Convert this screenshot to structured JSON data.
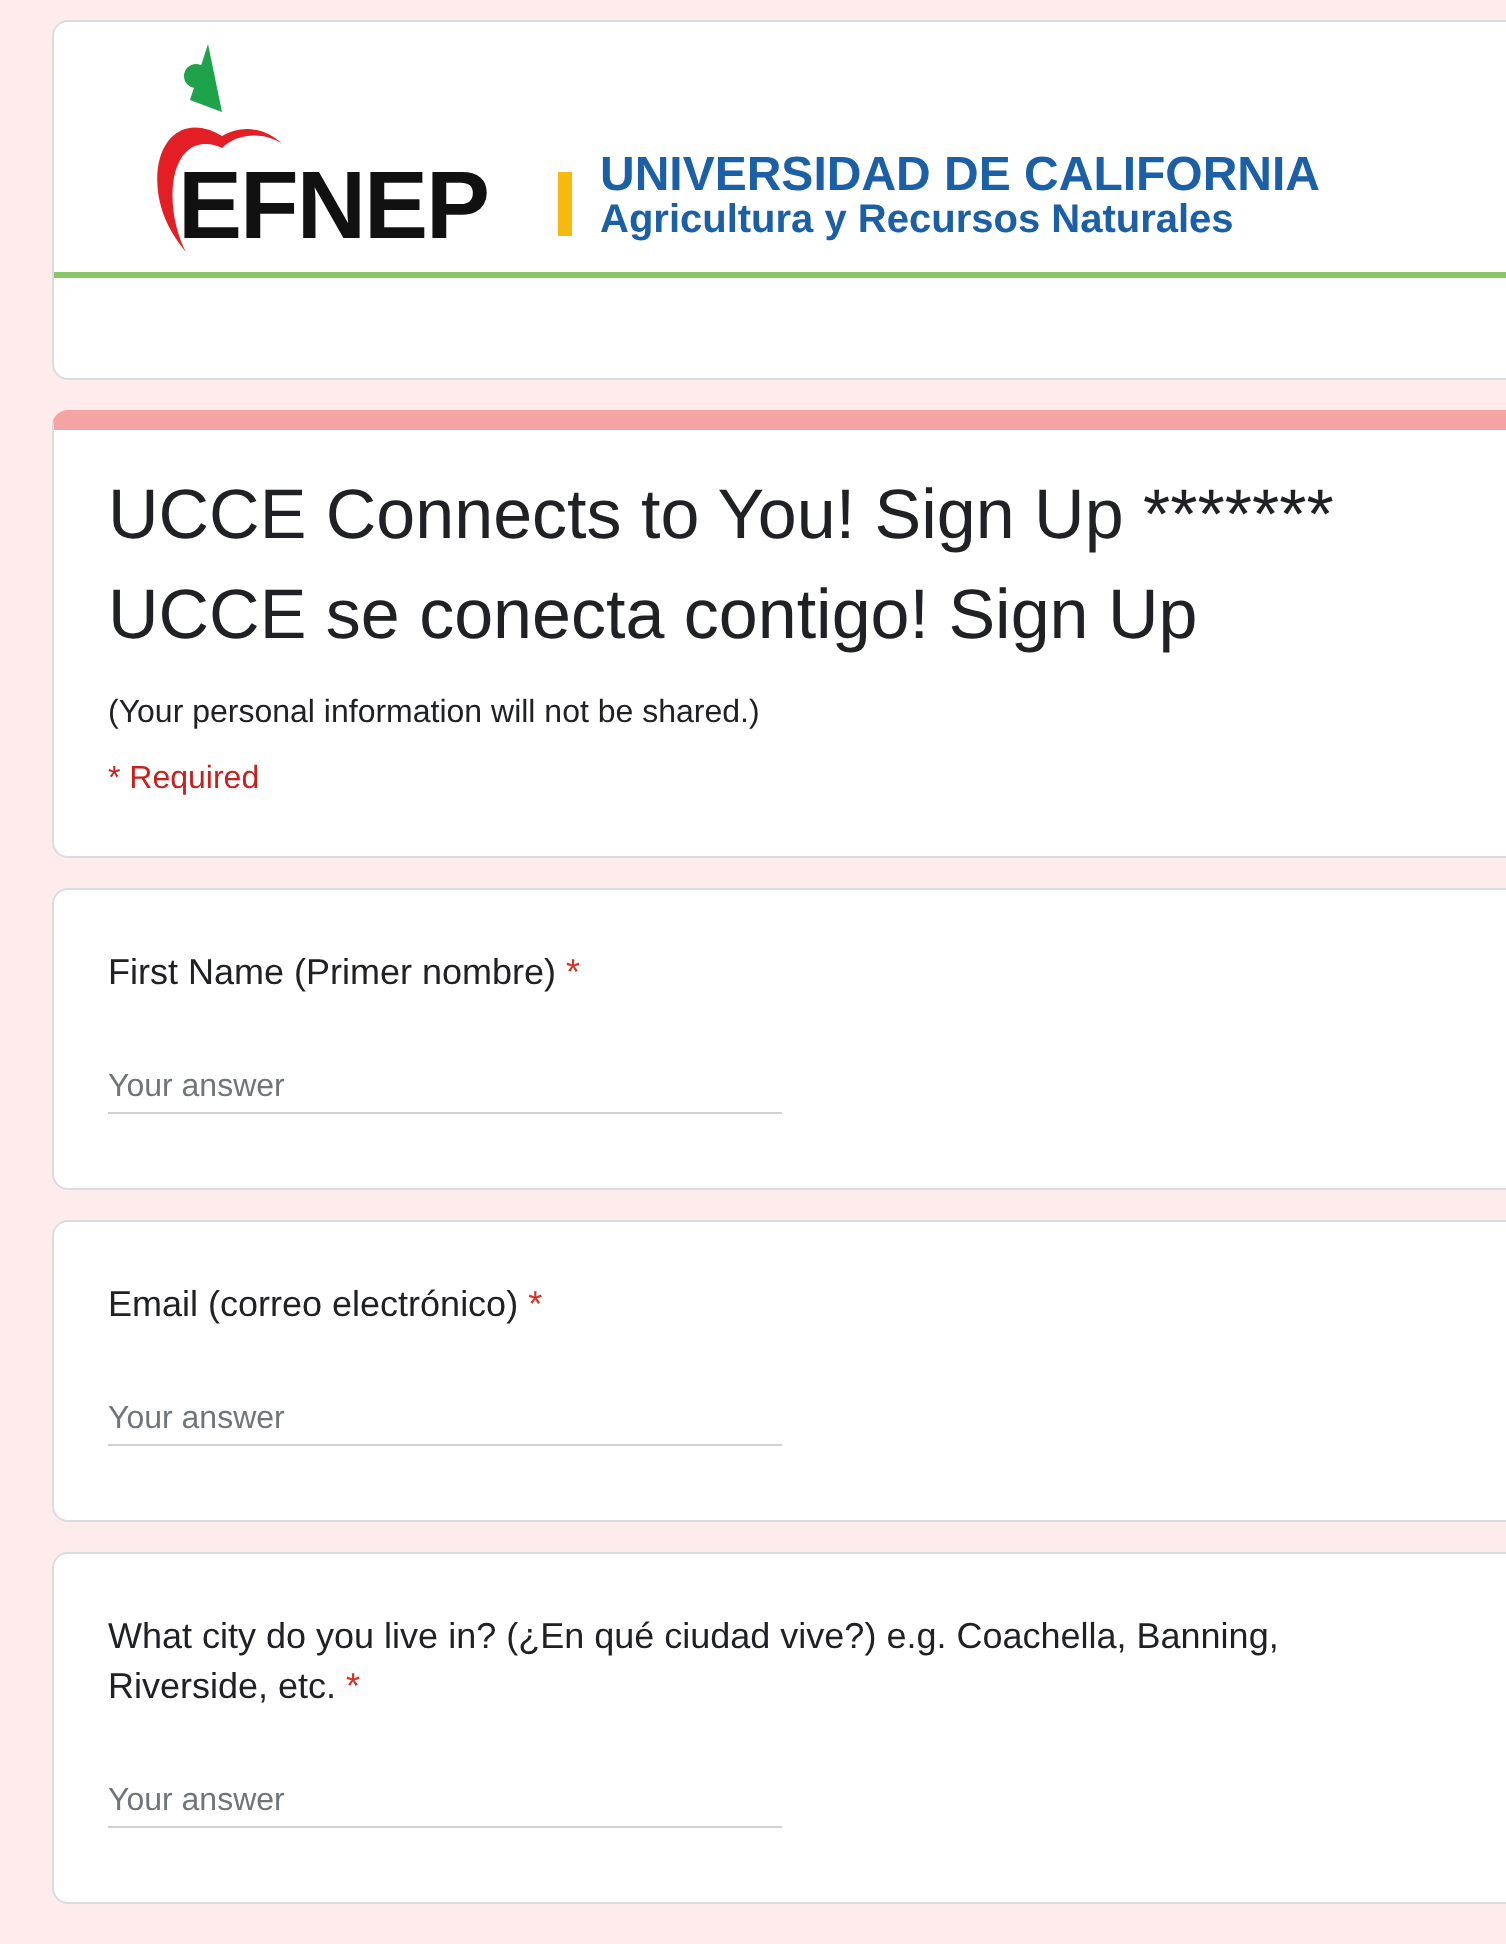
{
  "header": {
    "logo_text": "EFNEP",
    "university": "UNIVERSIDAD DE CALIFORNIA",
    "division": "Agricultura y Recursos Naturales"
  },
  "form": {
    "title_lines": [
      "UCCE Connects to You! Sign Up *******",
      "UCCE se conecta contigo! Sign Up"
    ],
    "description": "(Your personal information will not be shared.)",
    "required_note": "* Required"
  },
  "questions": [
    {
      "label": "First Name (Primer nombre)",
      "required_mark": "*",
      "placeholder": "Your answer"
    },
    {
      "label": "Email (correo electrónico)",
      "required_mark": "*",
      "placeholder": "Your answer"
    },
    {
      "label": "What city do you live in? (¿En qué ciudad vive?) e.g. Coachella, Banning, Riverside, etc.",
      "required_mark": "*",
      "placeholder": "Your answer"
    }
  ]
}
